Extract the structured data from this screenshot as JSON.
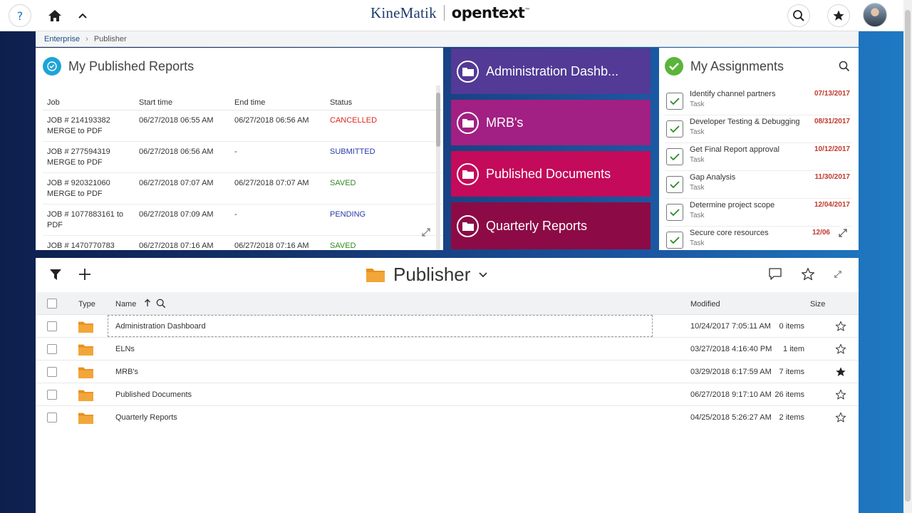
{
  "header": {
    "brand_left": "KineMatik",
    "brand_right": "opentext",
    "brand_tm": "™",
    "icons": [
      "help-icon",
      "home-icon",
      "chevron-up-icon",
      "search-icon",
      "star-icon",
      "avatar"
    ]
  },
  "breadcrumb": {
    "root": "Enterprise",
    "separator": "›",
    "current": "Publisher"
  },
  "reports_widget": {
    "title": "My Published Reports",
    "columns": [
      "Job",
      "Start time",
      "End time",
      "Status"
    ],
    "rows": [
      {
        "job1": "JOB # 214193382",
        "job2": "MERGE to PDF",
        "start": "06/27/2018 06:55 AM",
        "end": "06/27/2018 06:56 AM",
        "status": "CANCELLED"
      },
      {
        "job1": "JOB # 277594319",
        "job2": "MERGE to PDF",
        "start": "06/27/2018 06:56 AM",
        "end": "-",
        "status": "SUBMITTED"
      },
      {
        "job1": "JOB # 920321060",
        "job2": "MERGE to PDF",
        "start": "06/27/2018 07:07 AM",
        "end": "06/27/2018 07:07 AM",
        "status": "SAVED"
      },
      {
        "job1": "JOB # 1077883161 to",
        "job2": "PDF",
        "start": "06/27/2018 07:09 AM",
        "end": "-",
        "status": "PENDING"
      },
      {
        "job1": "JOB # 1470770783",
        "job2": "",
        "start": "06/27/2018 07:16 AM",
        "end": "06/27/2018 07:16 AM",
        "status": "SAVED"
      }
    ],
    "status_colors": {
      "CANCELLED": "#e0261d",
      "SUBMITTED": "#2a3aa8",
      "SAVED": "#2e8a1e",
      "PENDING": "#2a3aa8"
    }
  },
  "tiles": [
    {
      "label": "Administration Dashb...",
      "color": "#523a96"
    },
    {
      "label": "MRB's",
      "color": "#a21f83"
    },
    {
      "label": "Published Documents",
      "color": "#c40a5a"
    },
    {
      "label": "Quarterly Reports",
      "color": "#8c0b46"
    }
  ],
  "assignments_widget": {
    "title": "My Assignments",
    "items": [
      {
        "name": "Identify channel partners",
        "type": "Task",
        "date": "07/13/2017"
      },
      {
        "name": "Developer Testing & Debugging",
        "type": "Task",
        "date": "08/31/2017"
      },
      {
        "name": "Get Final Report approval",
        "type": "Task",
        "date": "10/12/2017"
      },
      {
        "name": "Gap Analysis",
        "type": "Task",
        "date": "11/30/2017"
      },
      {
        "name": "Determine project scope",
        "type": "Task",
        "date": "12/04/2017"
      },
      {
        "name": "Secure core resources",
        "type": "Task",
        "date": "12/06"
      }
    ]
  },
  "browse": {
    "title": "Publisher",
    "columns": {
      "type": "Type",
      "name": "Name",
      "modified": "Modified",
      "size": "Size"
    },
    "rows": [
      {
        "name": "Administration Dashboard",
        "modified": "10/24/2017 7:05:11 AM",
        "size": "0 items",
        "favorite": false
      },
      {
        "name": "ELNs",
        "modified": "03/27/2018 4:16:40 PM",
        "size": "1 item",
        "favorite": false
      },
      {
        "name": "MRB's",
        "modified": "03/29/2018 6:17:59 AM",
        "size": "7 items",
        "favorite": true
      },
      {
        "name": "Published Documents",
        "modified": "06/27/2018 9:17:10 AM",
        "size": "26 items",
        "favorite": false
      },
      {
        "name": "Quarterly Reports",
        "modified": "04/25/2018 5:26:27 AM",
        "size": "2 items",
        "favorite": false
      }
    ],
    "folder_color": "#e8901c"
  }
}
